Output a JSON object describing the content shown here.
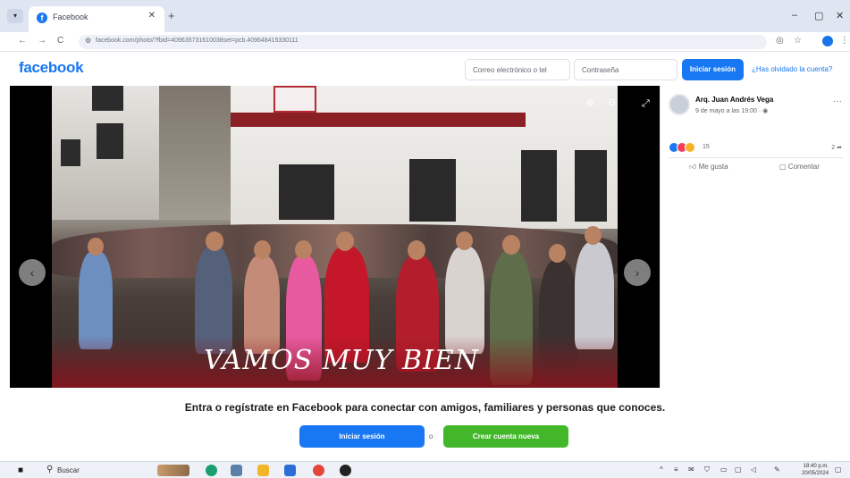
{
  "browser": {
    "tab_title": "Facebook",
    "tab_menu_icon": "chevron-down-icon",
    "new_tab": "+",
    "url": "facebook.com/photo/?fbid=409635731610038set=pcb.409648415330111",
    "window_controls": {
      "minimize": "–",
      "maximize": "▢",
      "close": "✕"
    },
    "nav": {
      "back": "←",
      "forward": "→",
      "reload": "C"
    }
  },
  "fb_header": {
    "logo": "facebook",
    "email_placeholder": "Correo electrónico o tel",
    "password_placeholder": "Contraseña",
    "login_button": "Iniciar sesión",
    "forgot_link": "¿Has olvidado la cuenta?"
  },
  "photo": {
    "slogan": "VAMOS MUY  BIEN",
    "prev_icon": "‹",
    "next_icon": "›"
  },
  "post": {
    "author": "Arq. Juan Andrés Vega",
    "date": "9 de mayo a las 19:00 · ",
    "reaction_count": "15",
    "share_count": "2",
    "like_label": "Me gusta",
    "comment_label": "Comentar",
    "more_icon": "···"
  },
  "cta": {
    "message": "Entra o regístrate en Facebook para conectar con amigos, familiares y personas que conoces.",
    "login_button": "Iniciar sesión",
    "or": "o",
    "create_button": "Crear cuenta nueva"
  },
  "taskbar": {
    "search_label": "Buscar",
    "clock_time": "18:40 p.m.",
    "clock_date": "20/05/2024"
  },
  "colors": {
    "fb_blue": "#1877f2",
    "fb_green": "#42b72a"
  }
}
